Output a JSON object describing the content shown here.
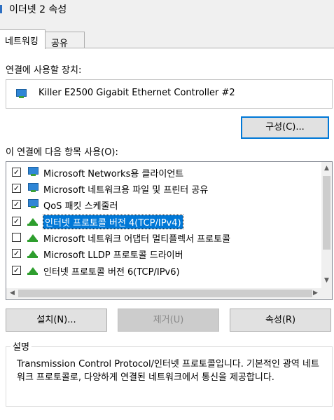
{
  "window": {
    "title": "이더넷 2 속성"
  },
  "tabs": [
    {
      "label": "네트워킹"
    },
    {
      "label": "공유"
    }
  ],
  "connect_using": {
    "label": "연결에 사용할 장치:",
    "device": "Killer E2500 Gigabit Ethernet Controller #2",
    "configure_label": "구성(C)..."
  },
  "items_section": {
    "label": "이 연결에 다음 항목 사용(O):",
    "items": [
      {
        "label": "Microsoft Networks용 클라이언트",
        "checked": true,
        "icon": "network-client-icon"
      },
      {
        "label": "Microsoft 네트워크용 파일 및 프린터 공유",
        "checked": true,
        "icon": "network-service-icon"
      },
      {
        "label": "QoS 패킷 스케줄러",
        "checked": true,
        "icon": "network-service-icon"
      },
      {
        "label": "인터넷 프로토콜 버전 4(TCP/IPv4)",
        "checked": true,
        "icon": "protocol-icon",
        "selected": true
      },
      {
        "label": "Microsoft 네트워크 어댑터 멀티플렉서 프로토콜",
        "checked": false,
        "icon": "protocol-icon"
      },
      {
        "label": "Microsoft LLDP 프로토콜 드라이버",
        "checked": true,
        "icon": "protocol-icon"
      },
      {
        "label": "인터넷 프로토콜 버전 6(TCP/IPv6)",
        "checked": true,
        "icon": "protocol-icon"
      }
    ]
  },
  "buttons": {
    "install": "설치(N)...",
    "uninstall": "제거(U)",
    "properties": "속성(R)"
  },
  "description": {
    "title": "설명",
    "text": "Transmission Control Protocol/인터넷 프로토콜입니다. 기본적인 광역 네트워크 프로토콜로, 다양하게 연결된 네트워크에서 통신을 제공합니다."
  },
  "colors": {
    "selection": "#0078d7",
    "accent": "#0078d7"
  }
}
